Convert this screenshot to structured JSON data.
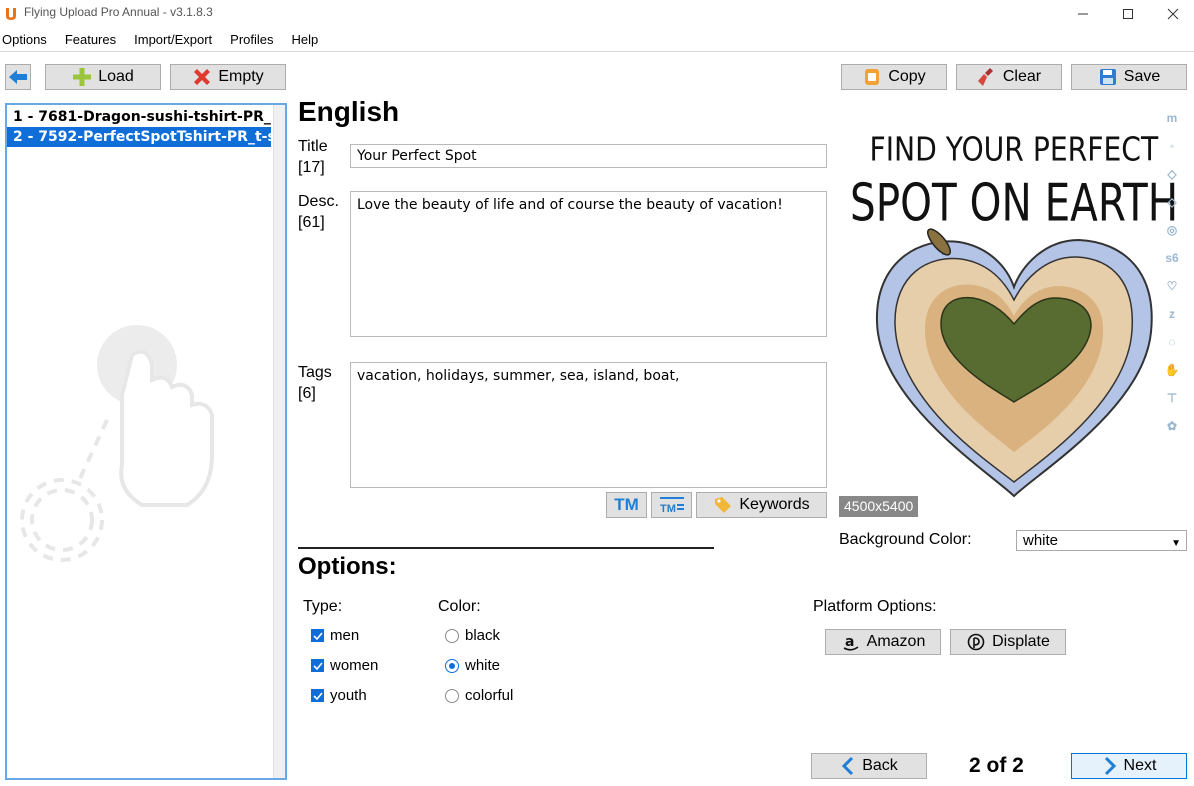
{
  "window": {
    "title": "Flying Upload Pro Annual - v3.1.8.3"
  },
  "menu": [
    "Options",
    "Features",
    "Import/Export",
    "Profiles",
    "Help"
  ],
  "toolbar": {
    "load_label": "Load",
    "empty_label": "Empty",
    "copy_label": "Copy",
    "clear_label": "Clear",
    "save_label": "Save"
  },
  "file_list": {
    "items": [
      "1 - 7681-Dragon-sushi-tshirt-PR_",
      "2 - 7592-PerfectSpotTshirt-PR_t-s"
    ],
    "selected_index": 1
  },
  "form": {
    "language": "English",
    "title_label": "Title",
    "title_count": "[17]",
    "title_value": "Your Perfect Spot",
    "desc_label": "Desc.",
    "desc_count": "[61]",
    "desc_value": "Love the beauty of life and of course the beauty of vacation!",
    "tags_label": "Tags",
    "tags_count": "[6]",
    "tags_value": "vacation, holidays, summer, sea, island, boat,",
    "tm_label": "TM",
    "keywords_label": "Keywords"
  },
  "options": {
    "heading": "Options:",
    "type_heading": "Type:",
    "types": [
      {
        "label": "men",
        "checked": true
      },
      {
        "label": "women",
        "checked": true
      },
      {
        "label": "youth",
        "checked": true
      }
    ],
    "color_heading": "Color:",
    "colors": [
      {
        "label": "black",
        "selected": false
      },
      {
        "label": "white",
        "selected": true
      },
      {
        "label": "colorful",
        "selected": false
      }
    ]
  },
  "preview": {
    "text_line1": "FIND YOUR PERFECT",
    "text_line2": "SPOT ON EARTH",
    "dimensions": "4500x5400",
    "background_label": "Background Color:",
    "background_value": "white"
  },
  "platform": {
    "heading": "Platform Options:",
    "amazon_label": "Amazon",
    "displate_label": "Displate"
  },
  "nav": {
    "back_label": "Back",
    "page_count": "2 of 2",
    "next_label": "Next"
  },
  "colors": {
    "accent": "#0f6ed8",
    "button_bg": "#e1e1e1",
    "button_border": "#adadad",
    "list_border": "#6aa7e6"
  }
}
